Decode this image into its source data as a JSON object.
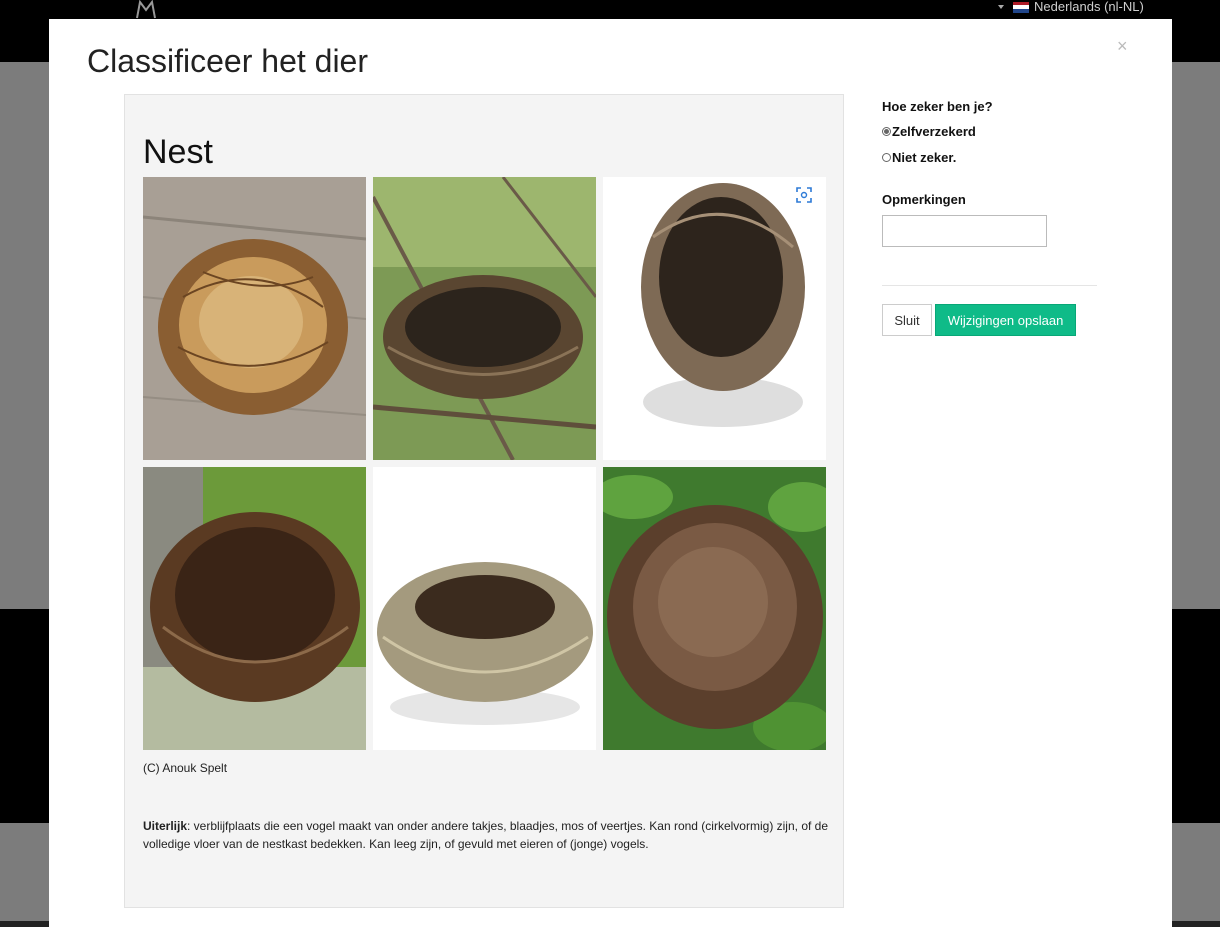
{
  "background": {
    "language_label": "Nederlands (nl-NL)",
    "flag_colors": [
      "#ae1c28",
      "#ffffff",
      "#21468b"
    ]
  },
  "modal": {
    "title": "Classificeer het dier",
    "close_symbol": "×"
  },
  "card": {
    "species": "Nest",
    "credit": "(C) Anouk Spelt",
    "description_term": "Uiterlijk",
    "description_text": ": verblijfplaats die een vogel maakt van onder andere takjes, blaadjes, mos of veertjes. Kan rond (cirkelvormig) zijn, of de volledige vloer van de nestkast bedekken. Kan leeg zijn, of gevuld met eieren of (jonge) vogels.",
    "expand_icon": "fullscreen-icon"
  },
  "form": {
    "certainty_question": "Hoe zeker ben je?",
    "options": [
      {
        "label": "Zelfverzekerd",
        "selected": true
      },
      {
        "label": "Niet zeker.",
        "selected": false
      }
    ],
    "remarks_label": "Opmerkingen",
    "remarks_value": "",
    "close_button": "Sluit",
    "save_button": "Wijzigingen opslaan"
  },
  "colors": {
    "save_button": "#0fbb88",
    "overlay_gray": "#7c7c7c",
    "card_bg": "#f4f4f4"
  }
}
